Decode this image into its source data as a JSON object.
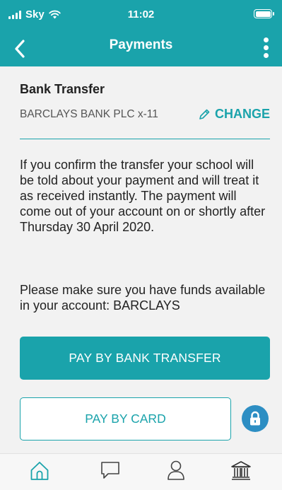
{
  "status_bar": {
    "carrier": "Sky",
    "time": "11:02"
  },
  "nav": {
    "title": "Payments"
  },
  "payment": {
    "method_title": "Bank Transfer",
    "bank_account": "BARCLAYS BANK PLC x-11",
    "change_label": "CHANGE"
  },
  "info": {
    "paragraph1": "If you confirm the transfer your school will be told about your payment and will treat it as received instantly. The payment will come out of your account on or shortly after Thursday 30 April 2020.",
    "paragraph2": "Please make sure you have funds available in your account: BARCLAYS"
  },
  "actions": {
    "primary_label": "PAY BY BANK TRANSFER",
    "secondary_label": "PAY BY CARD"
  },
  "tabbar": {
    "items": [
      "home-icon",
      "chat-icon",
      "profile-icon",
      "bank-icon"
    ]
  },
  "colors": {
    "accent": "#1aa3ab",
    "lock": "#2d8ec3",
    "background": "#f2f2f2"
  }
}
